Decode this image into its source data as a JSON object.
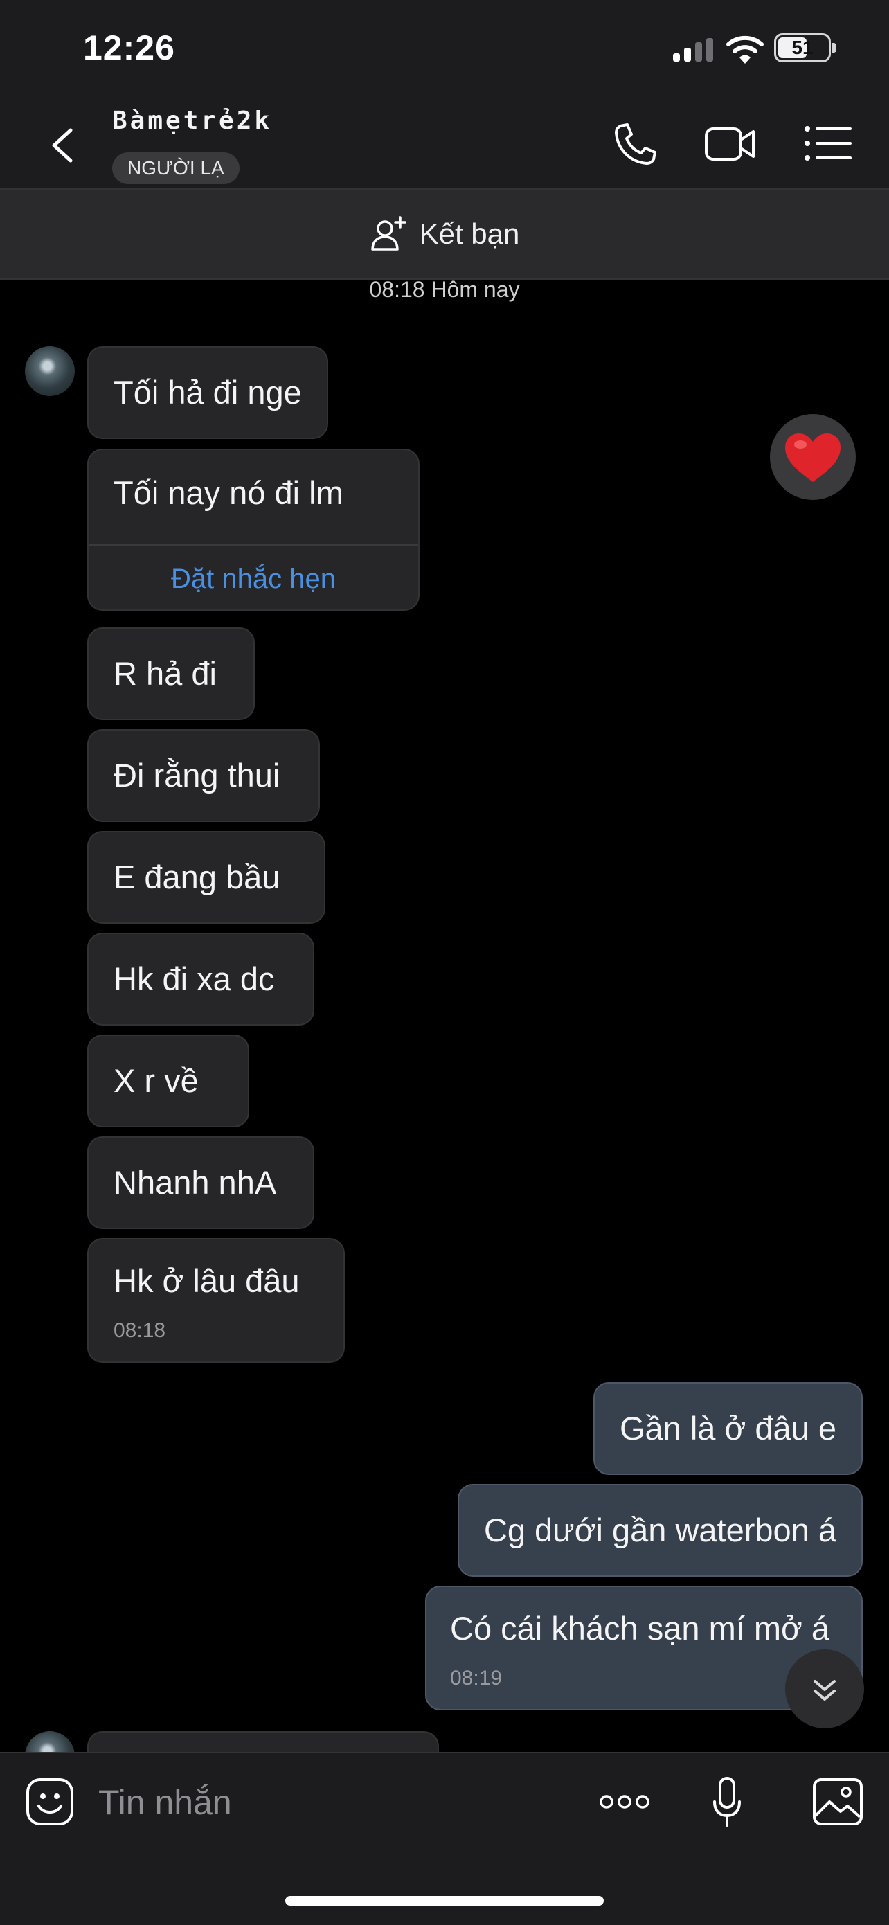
{
  "status_bar": {
    "time": "12:26",
    "battery": "51",
    "battery_level": 0.51
  },
  "header": {
    "contact_name": "Bàmẹtrẻ2k",
    "badge": "NGƯỜI LẠ",
    "icons": [
      "back-icon",
      "phone-icon",
      "video-icon",
      "menu-list-icon"
    ]
  },
  "add_friend": {
    "label": "Kết bạn",
    "icon": "add-person-icon"
  },
  "day_separator": "08:18 Hôm nay",
  "messages_in": [
    {
      "text": "Tối hả đi nge"
    },
    {
      "text": "Tối nay nó đi lm",
      "action": "Đặt nhắc hẹn"
    },
    {
      "text": "R hả đi"
    },
    {
      "text": "Đi rằng thui"
    },
    {
      "text": "E đang bầu"
    },
    {
      "text": "Hk đi xa dc"
    },
    {
      "text": "X r về"
    },
    {
      "text": "Nhanh nhA"
    },
    {
      "text": "Hk ở lâu đâu",
      "time": "08:18"
    }
  ],
  "messages_out": [
    {
      "text": "Gần là ở đâu e"
    },
    {
      "text": "Cg dưới gần waterbon á"
    },
    {
      "text": "Có cái khách sạn mí mở á",
      "time": "08:19"
    }
  ],
  "reaction": {
    "icon": "heart-icon",
    "color": "#e0242b"
  },
  "input": {
    "placeholder": "Tin nhắn",
    "icons": [
      "emoji-sticker-icon",
      "more-dots-icon",
      "microphone-icon",
      "image-gallery-icon"
    ]
  },
  "colors": {
    "background": "#000000",
    "incoming_bubble": "#262628",
    "outgoing_bubble": "#37404d",
    "link": "#4a90e2"
  }
}
